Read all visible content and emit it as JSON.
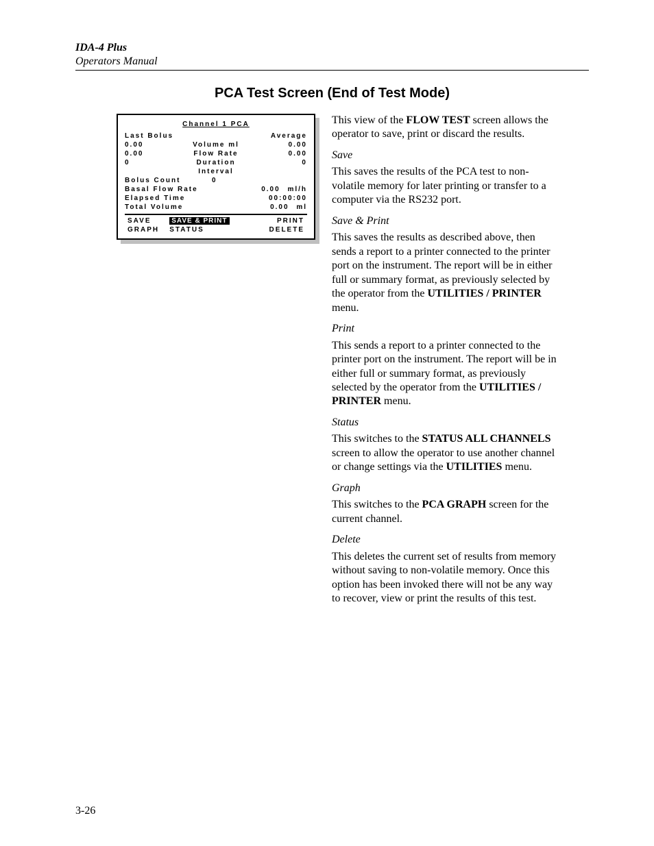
{
  "header": {
    "product": "IDA-4 Plus",
    "subtitle": "Operators Manual"
  },
  "section_title": "PCA Test Screen (End of Test Mode)",
  "screen": {
    "title": "Channel 1 PCA",
    "heading_left": "Last Bolus",
    "heading_right": "Average",
    "rows": [
      {
        "left": "0.00",
        "center": "Volume ml",
        "right": "0.00"
      },
      {
        "left": "0.00",
        "center": "Flow Rate",
        "right": "0.00"
      },
      {
        "left": "0",
        "center": "Duration",
        "right": "0"
      }
    ],
    "center_row": "Interval",
    "bolus_count_label": "Bolus Count",
    "bolus_count_value": "0",
    "basal_label": "Basal Flow Rate",
    "basal_value": "0.00",
    "basal_unit": "ml/h",
    "elapsed_label": "Elapsed Time",
    "elapsed_value": "00:00:00",
    "total_label": "Total Volume",
    "total_value": "0.00",
    "total_unit": "ml",
    "menu": {
      "save": "SAVE",
      "save_print": "SAVE & PRINT",
      "print": "PRINT",
      "graph": "GRAPH",
      "status": "STATUS",
      "delete": "DELETE"
    }
  },
  "text": {
    "intro_a": "This view of the ",
    "intro_b": "FLOW TEST",
    "intro_c": " screen allows the operator to save, print or discard the results.",
    "save_h": "Save",
    "save_p": "This saves the results of the PCA test to non-volatile memory for later printing or transfer to a computer via the RS232 port.",
    "sp_h": "Save & Print",
    "sp_p_a": "This saves the results as described above, then sends a report to a printer connected to the printer port on the instrument. The report will be in either full or summary format, as previously selected by the operator from the ",
    "sp_p_b": "UTILITIES / PRINTER",
    "sp_p_c": " menu.",
    "print_h": "Print",
    "print_p_a": "This sends a report to a printer connected to the printer port on the instrument. The report will be in either full or summary format, as previously selected by the operator from the ",
    "print_p_b": "UTILITIES / PRINTER",
    "print_p_c": " menu.",
    "status_h": "Status",
    "status_p_a": "This switches to the ",
    "status_p_b": "STATUS ALL CHANNELS",
    "status_p_c": " screen to allow the operator to use another channel or change settings via the ",
    "status_p_d": "UTILITIES",
    "status_p_e": " menu.",
    "graph_h": "Graph",
    "graph_p_a": "This switches to the ",
    "graph_p_b": "PCA GRAPH",
    "graph_p_c": " screen for the current channel.",
    "delete_h": "Delete",
    "delete_p": "This deletes the current set of results from memory without saving to non-volatile memory. Once this option has been invoked there will not be any way to recover, view or print the results of this test."
  },
  "page_number": "3-26"
}
